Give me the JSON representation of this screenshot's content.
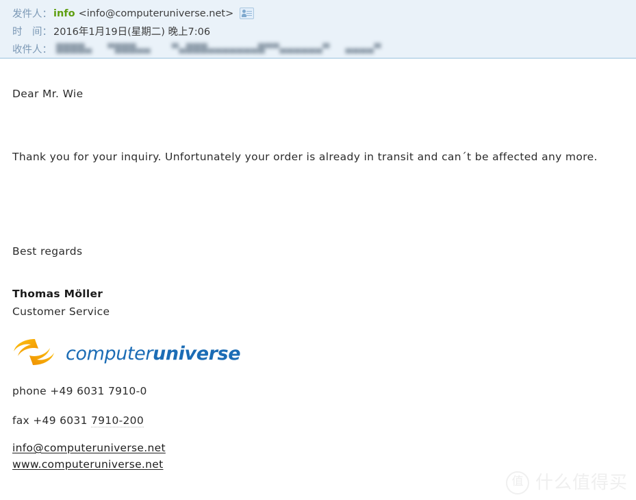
{
  "header": {
    "sender_label": "发件人：",
    "sender_name": "info",
    "sender_address": "<info@computeruniverse.net>",
    "contact_icon": "contact-card-icon",
    "date_label": "时　间：",
    "date_value": "2016年1月19日(星期二) 晚上7:06",
    "recipient_label": "收件人：",
    "recipient_value_redacted": "▮▮▮▮▮  ▮▮▮▮▮▮      ▮▮▮▮▮▮▮▮▮▮▮▮▮▮▮▮▮▮▮▮▮▮   ▮▮▮▮▮",
    "label_color": "#7b98b5",
    "sender_name_color": "#5e9e10",
    "background": "#eaf2f9",
    "border_color": "#c3dbec"
  },
  "body": {
    "greeting": "Dear Mr. Wie",
    "paragraph": "Thank you for your inquiry. Unfortunately your order is already in transit and can´t be affected any more.",
    "closing": "Best regards",
    "signature_name": "Thomas Möller",
    "signature_role": "Customer Service"
  },
  "logo": {
    "mark_name": "computeruniverse-swirl-mark",
    "text_part1": "computer",
    "text_part2": "universe",
    "text_color": "#1b6cb5",
    "mark_color_light": "#fcc011",
    "mark_color_dark": "#f29100"
  },
  "contact": {
    "phone": "phone +49 6031 7910-0",
    "fax_prefix": "fax +49 6031 ",
    "fax_number": "7910-200",
    "email": "info@computeruniverse.net",
    "website": "www.computeruniverse.net"
  },
  "watermark": {
    "badge_char": "值",
    "text": "什么值得买",
    "color": "#e2e2e2"
  }
}
